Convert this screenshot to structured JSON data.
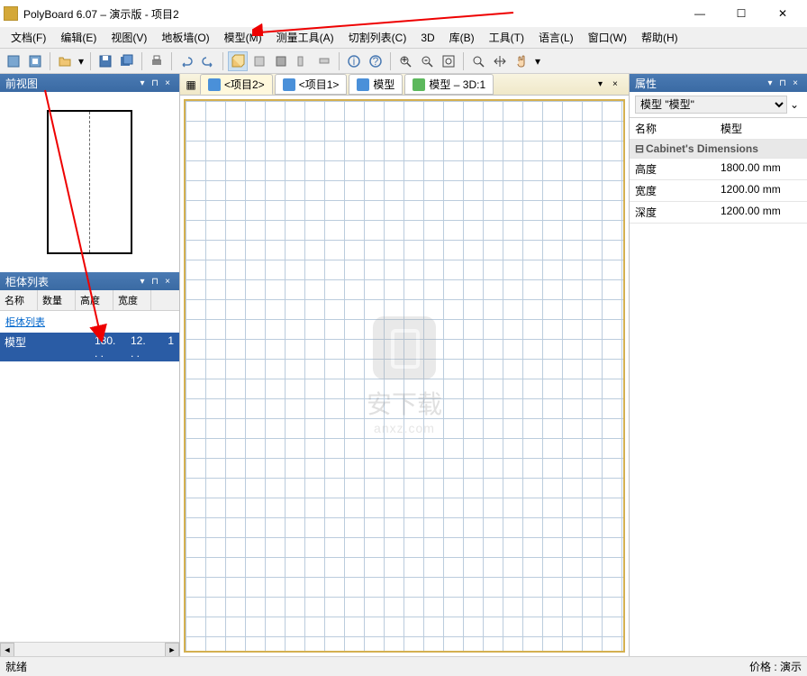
{
  "titlebar": {
    "app_icon": "polyboard-icon",
    "title": "PolyBoard 6.07 – 演示版 - 项目2"
  },
  "window_controls": {
    "min": "—",
    "max": "☐",
    "close": "✕"
  },
  "menu": {
    "file": "文档(F)",
    "edit": "编辑(E)",
    "view": "视图(V)",
    "floor": "地板墙(O)",
    "model": "模型(M)",
    "measure": "测量工具(A)",
    "cutlist": "切割列表(C)",
    "3d": "3D",
    "lib": "库(B)",
    "tool": "工具(T)",
    "lang": "语言(L)",
    "window": "窗口(W)",
    "help": "帮助(H)"
  },
  "frontview_panel": {
    "title": "前视图"
  },
  "cabinet_list_panel": {
    "title": "柜体列表",
    "columns": {
      "name": "名称",
      "qty": "数量",
      "h": "高度",
      "w": "宽度"
    },
    "link": "柜体列表",
    "row": {
      "name": "模型",
      "h": "180. . .",
      "w": "12. . .",
      "d": "1"
    }
  },
  "tabs": {
    "tab1": "<项目2>",
    "tab2": "<项目1>",
    "tab3": "模型",
    "tab4": "模型 – 3D:1"
  },
  "watermark": {
    "text": "安下载",
    "url": "anxz.com"
  },
  "properties_panel": {
    "title": "属性",
    "selector": "模型 \"模型\"",
    "name_label": "名称",
    "name_value": "模型",
    "section": "Cabinet's Dimensions",
    "height_label": "高度",
    "height_value": "1800.00 mm",
    "width_label": "宽度",
    "width_value": "1200.00 mm",
    "depth_label": "深度",
    "depth_value": "1200.00 mm"
  },
  "status": {
    "left": "就绪",
    "right": "价格 : 演示"
  }
}
